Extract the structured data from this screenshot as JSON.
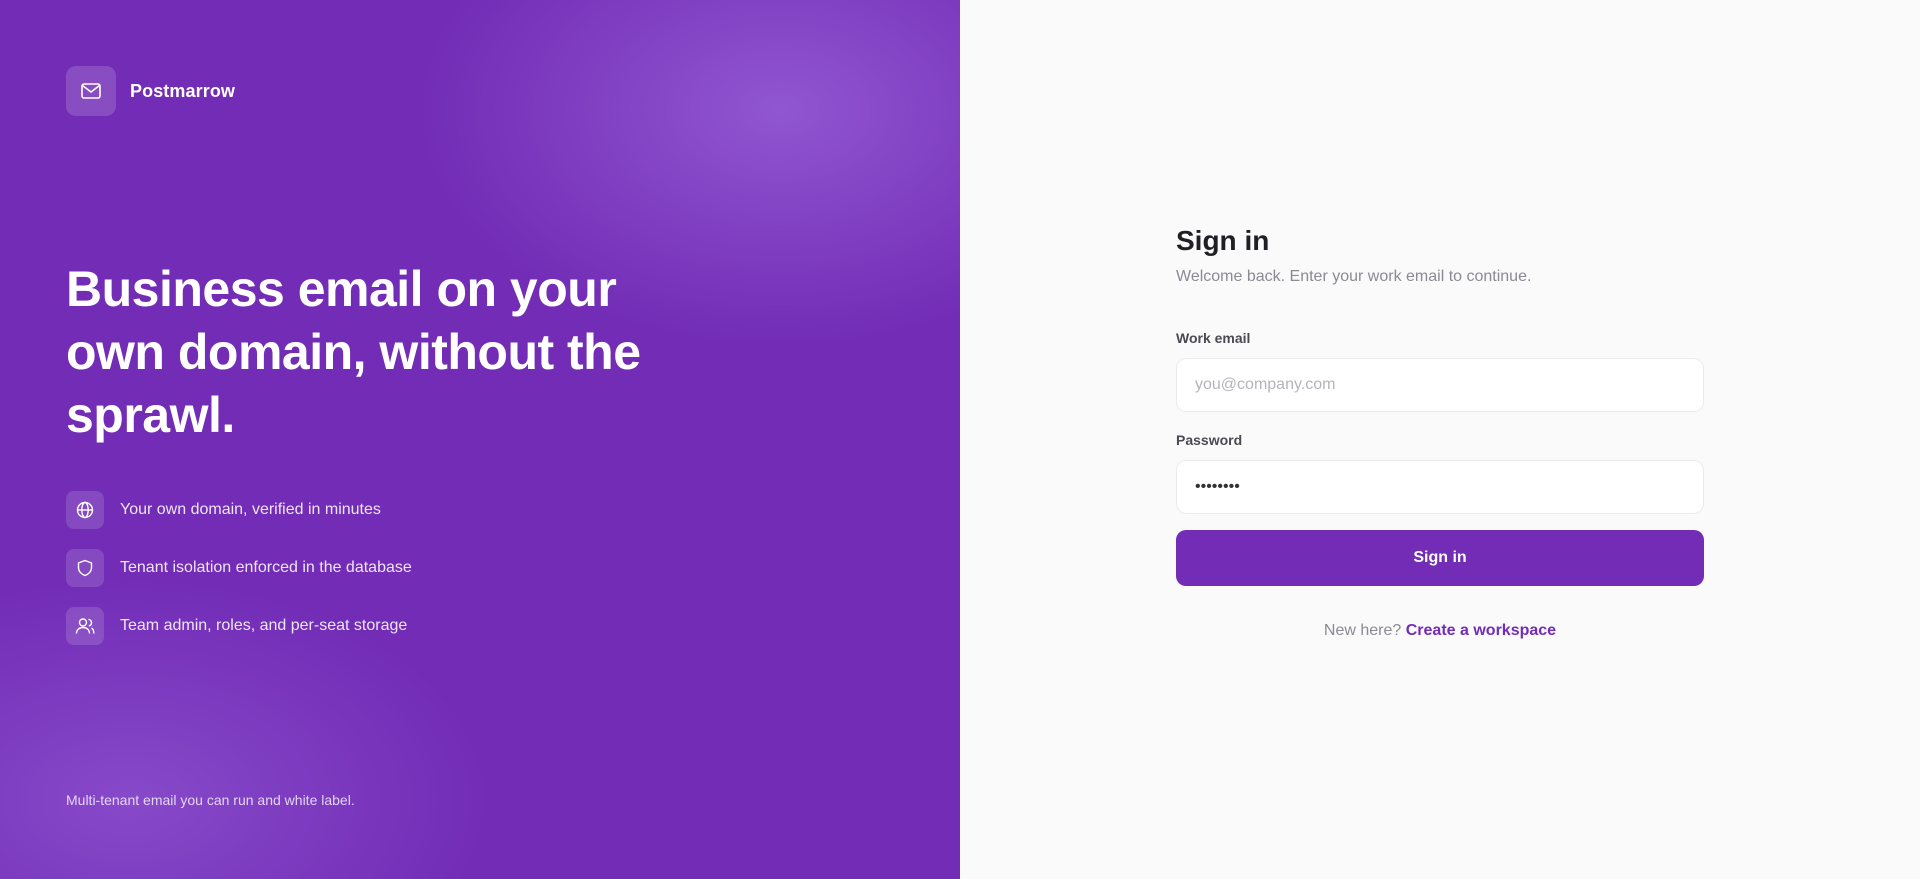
{
  "brand": {
    "name": "Postmarrow",
    "logo_icon": "mail-icon",
    "headline": "Business email on your own domain, without the sprawl.",
    "features": [
      {
        "icon": "globe-icon",
        "text": "Your own domain, verified in minutes"
      },
      {
        "icon": "shield-icon",
        "text": "Tenant isolation enforced in the database"
      },
      {
        "icon": "users-icon",
        "text": "Team admin, roles, and per-seat storage"
      }
    ],
    "tagline": "Multi-tenant email you can run and white label."
  },
  "signin": {
    "title": "Sign in",
    "subtitle": "Welcome back. Enter your work email to continue.",
    "email_label": "Work email",
    "email_placeholder": "you@company.com",
    "email_value": "",
    "password_label": "Password",
    "password_value": "password",
    "submit_label": "Sign in",
    "signup_prompt": "New here?",
    "signup_link": "Create a workspace"
  },
  "colors": {
    "brand_purple": "#722cb6",
    "panel_background": "#fafafb"
  }
}
